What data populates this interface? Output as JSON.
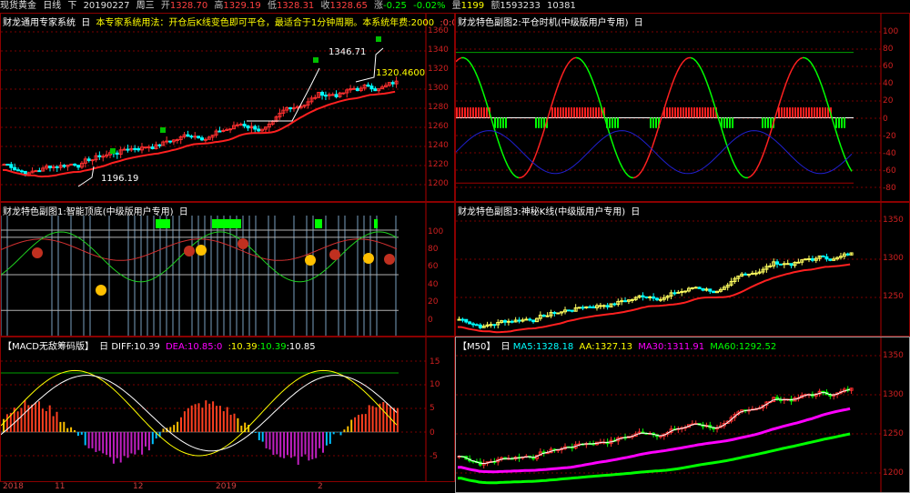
{
  "header": {
    "symbol": "现货黄金",
    "period": "日线",
    "dir": "下",
    "date": "20190227",
    "weekday": "周三",
    "open_label": "开",
    "open": "1328.70",
    "high_label": "高",
    "high": "1329.19",
    "low_label": "低",
    "low": "1328.31",
    "close_label": "收",
    "close": "1328.65",
    "change_label": "涨",
    "change": "-0.25",
    "change_pct": "-0.02%",
    "volume_label": "量",
    "volume": "1199",
    "amount_label": "额",
    "amount": "1593233",
    "extra": "10381"
  },
  "panels": {
    "main": {
      "title": "财龙通用专家系统",
      "collapse": "日",
      "desc": "本专家系统用法：开仓后K线变色即可平仓，最适合于1分钟周期。本系统年费",
      "fee": ":2000",
      "zero": ":0",
      "zero2": ":0",
      "annot_high": "1346.71",
      "annot_low": "1196.19",
      "annot_price": "1320.4600",
      "yticks": [
        "1360",
        "1340",
        "1320",
        "1300",
        "1280",
        "1260",
        "1240",
        "1220",
        "1200"
      ]
    },
    "sub2": {
      "title": "财龙特色副图2:平仓时机(中级版用户专用)",
      "collapse": "日",
      "yticks": [
        "100",
        "80",
        "60",
        "40",
        "20",
        "0",
        "-20",
        "-40",
        "-60",
        "-80"
      ]
    },
    "sub1": {
      "title": "财龙特色副图1:智能顶底(中级版用户专用)",
      "collapse": "日",
      "yticks": [
        "100",
        "80",
        "60",
        "40",
        "20",
        "0"
      ]
    },
    "sub3": {
      "title": "财龙特色副图3:神秘K线(中级版用户专用)",
      "collapse": "日",
      "yticks": [
        "1350",
        "1300",
        "1250"
      ]
    },
    "macd": {
      "title": "【MACD无敌筹码版】",
      "collapse": "日",
      "diff_label": "DIFF:",
      "diff": "10.39",
      "dea_label": "DEA:",
      "dea": "10.85",
      "v1": ":0",
      "v2": ":10.39",
      "v3": ":10.39",
      "v4": ":10.85",
      "yticks": [
        "15",
        "10",
        "5",
        "0",
        "-5"
      ]
    },
    "m50": {
      "title": "【M50】",
      "collapse": "日",
      "ma5_label": "MA5:",
      "ma5": "1328.18",
      "aa_label": "AA:",
      "aa": "1327.13",
      "ma30_label": "MA30:",
      "ma30": "1311.91",
      "ma60_label": "MA60:",
      "ma60": "1292.52",
      "yticks": [
        "1350",
        "1300",
        "1250",
        "1200"
      ]
    }
  },
  "xaxis": [
    "2018",
    "11",
    "12",
    "2019",
    "2"
  ],
  "colors": {
    "up": "#ff3030",
    "down": "#00ffff",
    "ma_red": "#ff2020",
    "green": "#00ff00",
    "yellow": "#ffff00",
    "magenta": "#ff00ff",
    "blue": "#2020ff",
    "axis": "#d02020"
  }
}
